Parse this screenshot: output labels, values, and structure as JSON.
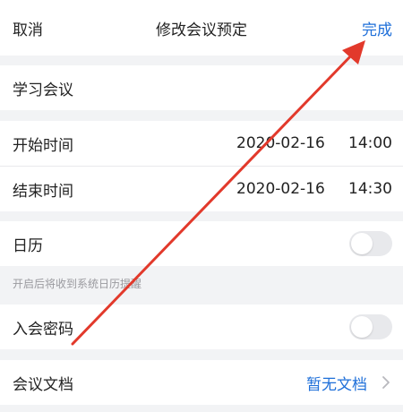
{
  "header": {
    "cancel_label": "取消",
    "title": "修改会议预定",
    "done_label": "完成"
  },
  "meeting": {
    "topic": "学习会议"
  },
  "schedule": {
    "start": {
      "label": "开始时间",
      "date": "2020-02-16",
      "time": "14:00"
    },
    "end": {
      "label": "结束时间",
      "date": "2020-02-16",
      "time": "14:30"
    }
  },
  "calendar": {
    "label": "日历",
    "enabled": false,
    "hint": "开启后将收到系统日历提醒"
  },
  "password": {
    "label": "入会密码",
    "enabled": false
  },
  "documents": {
    "label": "会议文档",
    "value": "暂无文档"
  },
  "colors": {
    "accent": "#1e6fd9",
    "annotation_arrow": "#e2392b"
  },
  "icons": {
    "documents_chevron": "chevron-right-icon"
  }
}
